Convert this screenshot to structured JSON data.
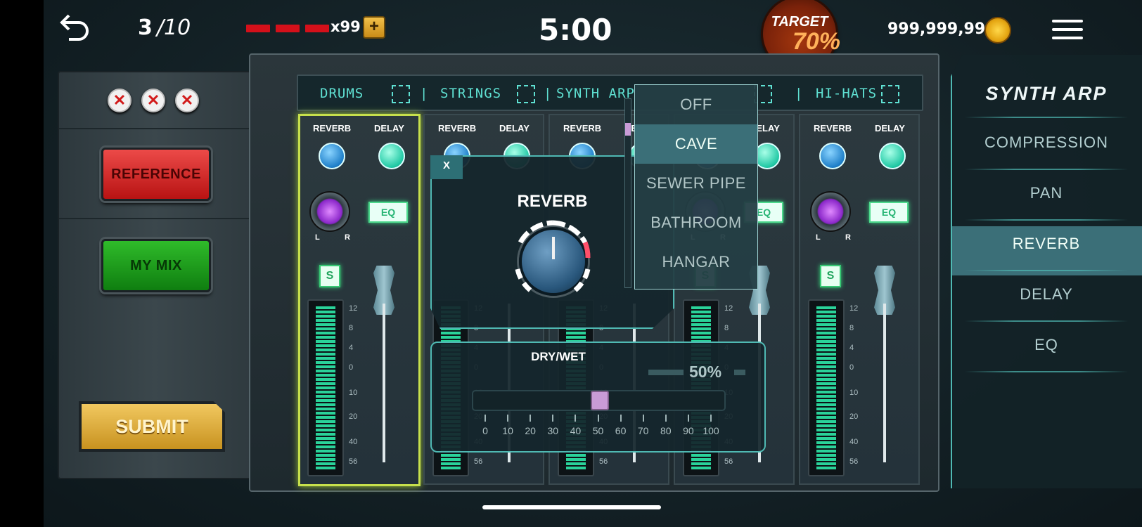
{
  "topbar": {
    "progress_current": "3",
    "progress_total": "/10",
    "lives_count": 3,
    "lives_multiplier": "x99",
    "plus_label": "+",
    "timer": "5:00",
    "target_label": "TARGET",
    "target_value": "70%",
    "coins": "999,999,999"
  },
  "left_panel": {
    "strikes": [
      "✕",
      "✕",
      "✕"
    ],
    "reference_label": "REFERENCE",
    "my_mix_label": "MY MIX",
    "submit_label": "SUBMIT"
  },
  "tracks": [
    "DRUMS",
    "STRINGS",
    "SYNTH ARP",
    "HI-HATS"
  ],
  "strip": {
    "reverb_label": "REVERB",
    "delay_label": "DELAY",
    "eq_label": "EQ",
    "solo_label": "S",
    "pan_left": "L",
    "pan_right": "R",
    "scale": [
      "12",
      "8",
      "4",
      "0",
      "10",
      "20",
      "40",
      "56"
    ]
  },
  "reverb_popup": {
    "title": "REVERB",
    "close_label": "X",
    "options": [
      "OFF",
      "CAVE",
      "SEWER PIPE",
      "BATHROOM",
      "HANGAR"
    ],
    "selected_option": "CAVE"
  },
  "dry_wet": {
    "title": "DRY/WET",
    "value_label": "50%",
    "value": 50,
    "ticks": [
      "0",
      "10",
      "20",
      "30",
      "40",
      "50",
      "60",
      "70",
      "80",
      "90",
      "100"
    ]
  },
  "right_panel": {
    "title": "SYNTH ARP",
    "items": [
      "COMPRESSION",
      "PAN",
      "REVERB",
      "DELAY",
      "EQ"
    ],
    "selected": "REVERB"
  },
  "colors": {
    "accent_teal": "#4fb9b3",
    "track_text": "#5fe0d2",
    "selected_strip": "#c7e04c",
    "target_orange": "#ffb15a"
  }
}
